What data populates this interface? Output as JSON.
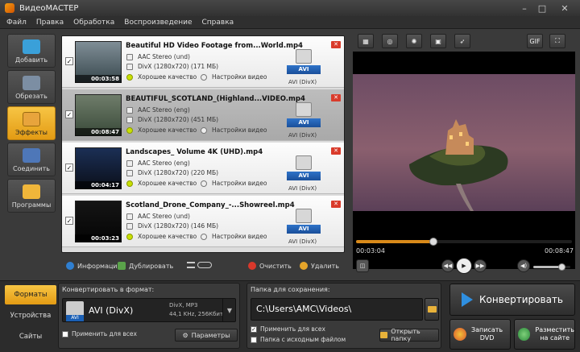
{
  "window": {
    "title": "ВидеоМАСТЕР",
    "minimize": "–",
    "maximize": "□",
    "close": "✕"
  },
  "menu": [
    "Файл",
    "Правка",
    "Обработка",
    "Воспроизведение",
    "Справка"
  ],
  "sidebar": [
    {
      "label": "Добавить",
      "icon": "add-film-icon",
      "color": "#3aa0d9"
    },
    {
      "label": "Обрезать",
      "icon": "scissors-film-icon",
      "color": "#7c8ea3"
    },
    {
      "label": "Эффекты",
      "icon": "effects-film-icon",
      "color": "#e8a43c",
      "active": true
    },
    {
      "label": "Соединить",
      "icon": "join-film-icon",
      "color": "#4e77b8"
    },
    {
      "label": "Программы",
      "icon": "programs-icon",
      "color": "#f0b63a"
    }
  ],
  "files": [
    {
      "name": "Beautiful HD Video Footage from...World.mp4",
      "audio": "AAC Stereo (und)",
      "video": "DivX (1280x720) (171 МБ)",
      "quality": "Хорошее качество",
      "settings": "Настройки видео",
      "duration": "00:03:58",
      "format_badge": "AVI",
      "format_label": "AVI (DivX)",
      "checked": "✓",
      "thumb_top": "#7f8d96",
      "thumb_bottom": "#2f3a3f",
      "selected": false
    },
    {
      "name": "BEAUTIFUL_SCOTLAND_(Highland...VIDEO.mp4",
      "audio": "AAC Stereo (eng)",
      "video": "DivX (1280x720) (451 МБ)",
      "quality": "Хорошее качество",
      "settings": "Настройки видео",
      "duration": "00:08:47",
      "format_badge": "AVI",
      "format_label": "AVI (DivX)",
      "checked": "✓",
      "thumb_top": "#6f7d6a",
      "thumb_bottom": "#3a4a3a",
      "selected": true
    },
    {
      "name": "Landscapes_ Volume 4K (UHD).mp4",
      "audio": "AAC Stereo (eng)",
      "video": "DivX (1280x720) (220 МБ)",
      "quality": "Хорошее качество",
      "settings": "Настройки видео",
      "duration": "00:04:17",
      "format_badge": "AVI",
      "format_label": "AVI (DivX)",
      "checked": "✓",
      "thumb_top": "#1b2f55",
      "thumb_bottom": "#0b0f1a",
      "selected": false
    },
    {
      "name": "Scotland_Drone_Company_-...Showreel.mp4",
      "audio": "AAC Stereo (und)",
      "video": "DivX (1280x720) (146 МБ)",
      "quality": "Хорошее качество",
      "settings": "Настройки видео",
      "duration": "00:03:23",
      "format_badge": "AVI",
      "format_label": "AVI (DivX)",
      "checked": "✓",
      "thumb_top": "#151515",
      "thumb_bottom": "#050505",
      "selected": false
    }
  ],
  "list_toolbar": {
    "info": "Информация",
    "duplicate": "Дублировать",
    "clear": "Очистить",
    "delete": "Удалить"
  },
  "preview_tools": [
    "crop-icon",
    "rotate-icon",
    "brightness-icon",
    "stabilize-icon",
    "speed-icon"
  ],
  "preview_gif": "GIF",
  "player": {
    "current_time": "00:03:04",
    "total_time": "00:08:47",
    "progress": 0.36,
    "volume": 0.75
  },
  "bottom_tabs": [
    "Форматы",
    "Устройства",
    "Сайты"
  ],
  "format_panel": {
    "label": "Конвертировать в формат:",
    "format_name": "AVI (DivX)",
    "format_badge": "AVI",
    "codec_line1": "DivX, MP3",
    "codec_line2": "44,1 KHz, 256Кбит",
    "apply_all": "Применить для всех",
    "params": "Параметры"
  },
  "folder_panel": {
    "label": "Папка для сохранения:",
    "path": "C:\\Users\\AMC\\Videos\\",
    "apply_all": "Применить для всех",
    "source_folder": "Папка с исходным файлом",
    "open_folder": "Открыть папку"
  },
  "actions": {
    "convert": "Конвертировать",
    "dvd_line1": "Записать",
    "dvd_line2": "DVD",
    "publish_line1": "Разместить",
    "publish_line2": "на сайте"
  }
}
